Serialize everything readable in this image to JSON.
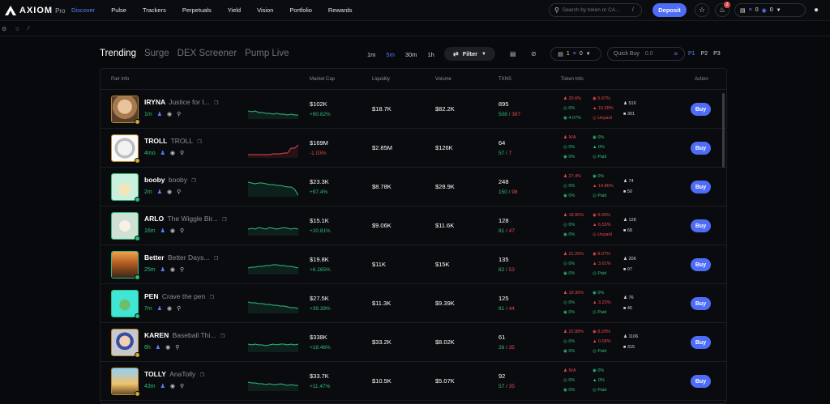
{
  "app": {
    "logo": "AXIOM",
    "logo_suffix": "Pro"
  },
  "nav": [
    "Discover",
    "Pulse",
    "Trackers",
    "Perpetuals",
    "Yield",
    "Vision",
    "Portfolio",
    "Rewards"
  ],
  "search": {
    "placeholder": "Search by token or CA...",
    "shortcut": "/"
  },
  "header": {
    "deposit": "Deposit",
    "notif_count": "2",
    "wallet_a": "0",
    "wallet_b": "0"
  },
  "tabs": [
    "Trending",
    "Surge",
    "DEX Screener",
    "Pump Live"
  ],
  "times": [
    "1m",
    "5m",
    "30m",
    "1h"
  ],
  "filter_label": "Filter",
  "count_box": {
    "a": "1",
    "b": "0"
  },
  "quick_buy": {
    "label": "Quick Buy",
    "value": "0.0"
  },
  "presets": [
    "P1",
    "P2",
    "P3"
  ],
  "columns": {
    "pair": "Pair Info",
    "mcap": "Market Cap",
    "liq": "Liquidity",
    "vol": "Volume",
    "txns": "TXNS",
    "token": "Token Info",
    "action": "Action"
  },
  "accent": "#4f6cf7",
  "rows": [
    {
      "name": "IRYNA",
      "full": "Justice for I...",
      "age": "1m",
      "mcap": "$102K",
      "mchg": "+90.82%",
      "mdir": "pos",
      "liq": "$18.7K",
      "vol": "$82.2K",
      "txns": "895",
      "buys": "508",
      "sells": "387",
      "ti": [
        "20.6%",
        "5.97%",
        "0%",
        "15.28%",
        "4.07%",
        "Unpaid"
      ],
      "h1": "516",
      "h2": "301",
      "buy": "Buy",
      "spark": [
        14,
        15,
        14,
        16,
        16,
        17,
        17,
        18,
        17,
        18,
        18,
        19,
        18,
        19,
        19
      ],
      "line": "#2dbf7a"
    },
    {
      "name": "TROLL",
      "full": "TROLL",
      "age": "4mo",
      "mcap": "$169M",
      "mchg": "-1.03%",
      "mdir": "neg",
      "liq": "$2.85M",
      "vol": "$126K",
      "txns": "64",
      "buys": "57",
      "sells": "7",
      "ti": [
        "N/A",
        "0%",
        "0%",
        "0%",
        "0%",
        "Paid"
      ],
      "h1": "",
      "h2": "",
      "buy": "Buy",
      "spark": [
        20,
        20,
        20,
        20,
        20,
        20,
        20,
        19,
        19,
        19,
        18,
        18,
        12,
        12,
        8
      ],
      "line": "#e5484d"
    },
    {
      "name": "booby",
      "full": "booby",
      "age": "2m",
      "mcap": "$23.3K",
      "mchg": "+97.4%",
      "mdir": "pos",
      "liq": "$8.78K",
      "vol": "$28.9K",
      "txns": "248",
      "buys": "150",
      "sells": "98",
      "ti": [
        "27.4%",
        "0%",
        "0%",
        "14.86%",
        "0%",
        "Paid"
      ],
      "h1": "74",
      "h2": "50",
      "buy": "Buy",
      "spark": [
        6,
        7,
        8,
        7,
        7,
        8,
        9,
        9,
        10,
        10,
        11,
        12,
        12,
        15,
        22
      ],
      "line": "#2dbf7a"
    },
    {
      "name": "ARLO",
      "full": "The Wiggle Bir...",
      "age": "16m",
      "mcap": "$15.1K",
      "mchg": "+20.81%",
      "mdir": "pos",
      "liq": "$9.06K",
      "vol": "$11.6K",
      "txns": "128",
      "buys": "81",
      "sells": "47",
      "ti": [
        "18.95%",
        "9.05%",
        "0%",
        "6.53%",
        "0%",
        "Unpaid"
      ],
      "h1": "128",
      "h2": "68",
      "buy": "Buy",
      "spark": [
        16,
        15,
        16,
        14,
        15,
        16,
        14,
        15,
        16,
        15,
        14,
        15,
        16,
        15,
        16
      ],
      "line": "#2dbf7a"
    },
    {
      "name": "Better",
      "full": "Better Days...",
      "age": "25m",
      "mcap": "$19.8K",
      "mchg": "+6.265%",
      "mdir": "pos",
      "liq": "$11K",
      "vol": "$15K",
      "txns": "135",
      "buys": "82",
      "sells": "53",
      "ti": [
        "21.25%",
        "8.07%",
        "0%",
        "3.61%",
        "0%",
        "Paid"
      ],
      "h1": "206",
      "h2": "97",
      "buy": "Buy",
      "spark": [
        16,
        15,
        15,
        14,
        14,
        13,
        13,
        12,
        12,
        13,
        13,
        14,
        14,
        15,
        16
      ],
      "line": "#2dbf7a"
    },
    {
      "name": "PEN",
      "full": "Crave the pen",
      "age": "7m",
      "mcap": "$27.5K",
      "mchg": "+39.39%",
      "mdir": "pos",
      "liq": "$11.3K",
      "vol": "$9.39K",
      "txns": "125",
      "buys": "81",
      "sells": "44",
      "ti": [
        "19.36%",
        "0%",
        "0%",
        "3.23%",
        "0%",
        "Paid"
      ],
      "h1": "76",
      "h2": "46",
      "buy": "Buy",
      "spark": [
        10,
        11,
        11,
        12,
        12,
        13,
        13,
        14,
        14,
        15,
        15,
        16,
        17,
        17,
        18
      ],
      "line": "#2dbf7a"
    },
    {
      "name": "KAREN",
      "full": "Baseball Thi...",
      "age": "6h",
      "mcap": "$338K",
      "mchg": "+18.46%",
      "mdir": "pos",
      "liq": "$33.2K",
      "vol": "$8.02K",
      "txns": "61",
      "buys": "26",
      "sells": "35",
      "ti": [
        "22.88%",
        "8.29%",
        "0%",
        "0.09%",
        "0%",
        "Paid"
      ],
      "h1": "1106",
      "h2": "315",
      "buy": "Buy",
      "spark": [
        14,
        15,
        14,
        15,
        15,
        16,
        15,
        14,
        15,
        14,
        14,
        15,
        14,
        15,
        14
      ],
      "line": "#2dbf7a"
    },
    {
      "name": "TOLLY",
      "full": "AnaTolly",
      "age": "43m",
      "mcap": "$33.7K",
      "mchg": "+11.47%",
      "mdir": "pos",
      "liq": "$10.5K",
      "vol": "$5.07K",
      "txns": "92",
      "buys": "57",
      "sells": "35",
      "ti": [
        "N/A",
        "0%",
        "0%",
        "0%",
        "0%",
        "Paid"
      ],
      "h1": "",
      "h2": "",
      "buy": "Buy",
      "spark": [
        13,
        14,
        14,
        15,
        15,
        16,
        15,
        16,
        16,
        15,
        16,
        17,
        16,
        17,
        17
      ],
      "line": "#2dbf7a"
    }
  ]
}
